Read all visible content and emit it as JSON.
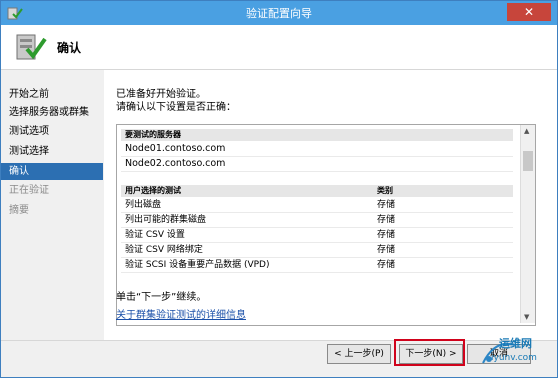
{
  "window": {
    "title": "验证配置向导",
    "close_glyph": "✕",
    "app_icon": "cluster-validation-icon"
  },
  "header": {
    "title": "确认",
    "icon": "validation-checkmark-icon"
  },
  "sidebar": {
    "items": [
      {
        "label": "开始之前",
        "state": "normal"
      },
      {
        "label": "选择服务器或群集",
        "state": "normal"
      },
      {
        "label": "测试选项",
        "state": "normal"
      },
      {
        "label": "测试选择",
        "state": "normal"
      },
      {
        "label": "确认",
        "state": "active"
      },
      {
        "label": "正在验证",
        "state": "disabled"
      },
      {
        "label": "摘要",
        "state": "disabled"
      }
    ]
  },
  "main": {
    "intro_line1": "已准备好开始验证。",
    "intro_line2": "请确认以下设置是否正确：",
    "servers_header": "要测试的服务器",
    "servers": [
      "Node01.contoso.com",
      "Node02.contoso.com"
    ],
    "tests_header": "用户选择的测试",
    "tests_category_header": "类别",
    "tests": [
      {
        "name": "列出磁盘",
        "category": "存储"
      },
      {
        "name": "列出可能的群集磁盘",
        "category": "存储"
      },
      {
        "name": "验证 CSV 设置",
        "category": "存储"
      },
      {
        "name": "验证 CSV 网络绑定",
        "category": "存储"
      },
      {
        "name": "验证 SCSI 设备重要产品数据 (VPD)",
        "category": "存储"
      }
    ],
    "continue_text": "单击“下一步”继续。",
    "more_info_link": "关于群集验证测试的详细信息"
  },
  "buttons": {
    "back": "< 上一步(P)",
    "next": "下一步(N) >",
    "cancel": "取消"
  },
  "watermark": {
    "line1": "运维网",
    "line2": "iyunv.com"
  },
  "colors": {
    "titlebar": "#4aa0e2",
    "active_nav": "#2c6fb2",
    "highlight_box": "#d0021b",
    "link": "#1a4fa8"
  }
}
